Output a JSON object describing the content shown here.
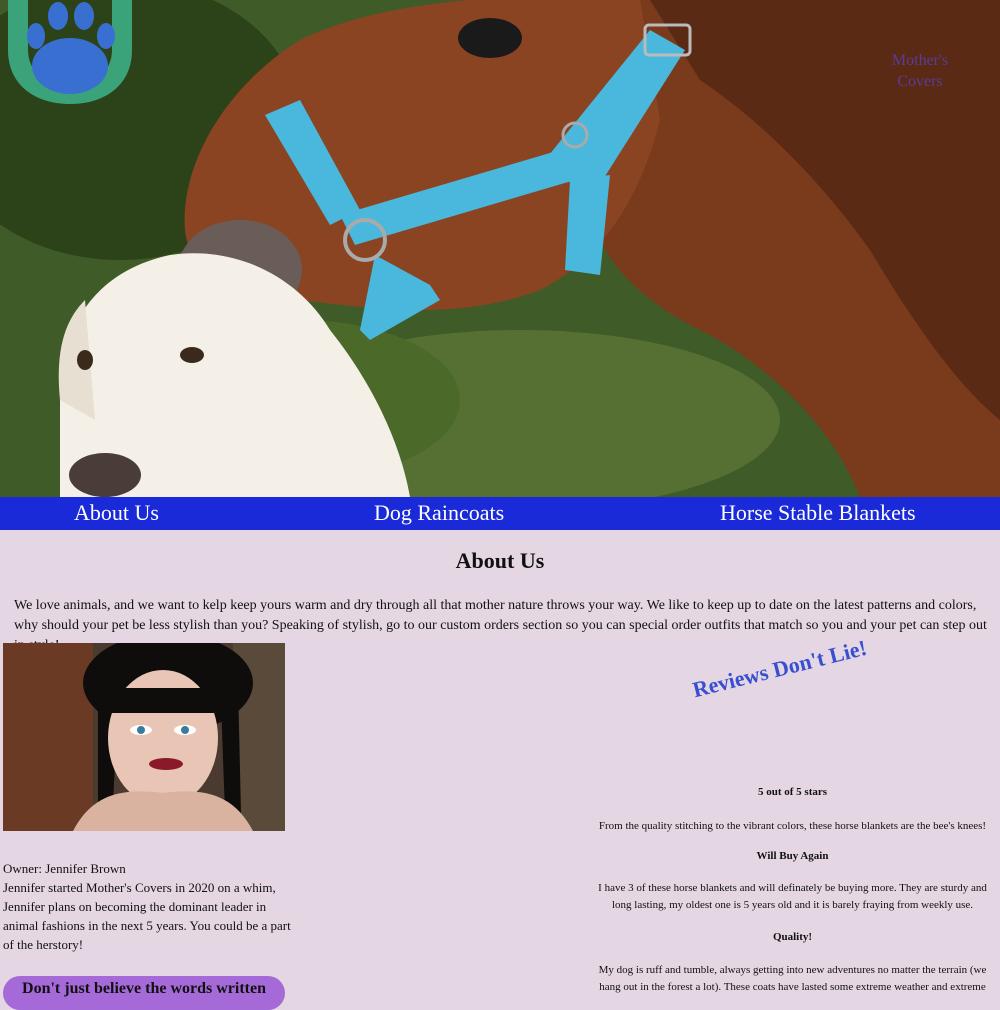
{
  "logo": {
    "line1": "Mother's",
    "line2": "Covers"
  },
  "nav": {
    "items": [
      "About Us",
      "Dog Raincoats",
      "Horse Stable Blankets"
    ]
  },
  "main": {
    "title": "About Us",
    "intro": "We love animals, and we want to kelp keep yours warm and dry through all that mother nature throws your way. We like to keep up to date on the latest patterns and colors, why should your pet be less stylish than you? Speaking of stylish, go to our custom orders section so you can special order outfits that match so you and your pet can step out in style!"
  },
  "owner": {
    "line": "Owner: Jennifer Brown",
    "bio": "Jennifer started Mother's Covers in 2020 on a whim, Jennifer plans on becoming the dominant leader in animal fashions in the next 5 years. You could be a part of the herstory!",
    "cta": "Don't just believe the words written"
  },
  "reviews": {
    "heading": "Reviews Don't Lie!",
    "items": [
      {
        "title": "5 out of 5 stars",
        "body": "From the quality stitching to the vibrant colors, these horse blankets are the bee's knees!"
      },
      {
        "title": "Will Buy Again",
        "body": "I have 3 of these horse blankets and will definately be buying more. They are sturdy and long lasting, my oldest one is 5 years old and it is barely fraying from weekly use."
      },
      {
        "title": "Quality!",
        "body": "My dog is ruff and tumble, always getting into new adventures no matter the terrain (we hang out in the forest a lot). These coats have lasted some extreme weather and extreme"
      }
    ]
  }
}
